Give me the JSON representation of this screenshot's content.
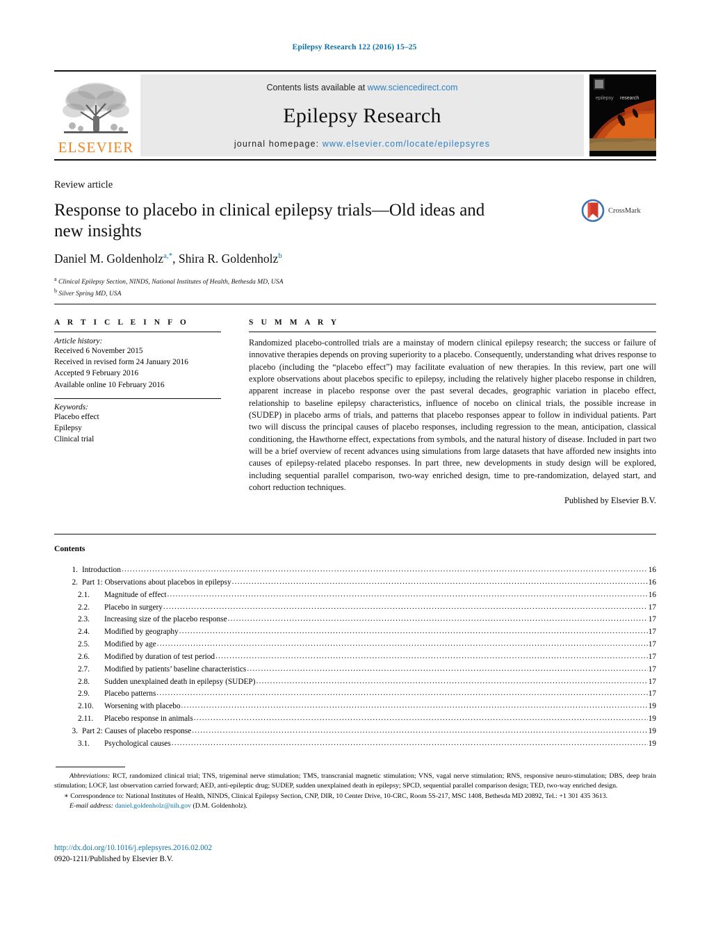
{
  "running_head": "Epilepsy Research 122 (2016) 15–25",
  "masthead": {
    "publisher_name": "ELSEVIER",
    "contents_prefix": "Contents lists available at ",
    "contents_link": "www.sciencedirect.com",
    "journal_title": "Epilepsy Research",
    "homepage_prefix": "journal homepage: ",
    "homepage_link": "www.elsevier.com/locate/epilepsyres",
    "cover_caption": "epilepsy research"
  },
  "article": {
    "kicker": "Review article",
    "title": "Response to placebo in clinical epilepsy trials—Old ideas and new insights",
    "authors": "Daniel M. Goldenholz",
    "author_1_sup": "a,*",
    "authors_2": ", Shira R. Goldenholz",
    "author_2_sup": "b",
    "affiliation_a_sup": "a",
    "affiliation_a": "Clinical Epilepsy Section, NINDS, National Institutes of Health, Bethesda MD, USA",
    "affiliation_b_sup": "b",
    "affiliation_b": "Silver Spring MD, USA",
    "crossmark_label": "CrossMark"
  },
  "article_info": {
    "heading": "A R T I C L E    I N F O",
    "history_label": "Article history:",
    "history": [
      "Received 6 November 2015",
      "Received in revised form 24 January 2016",
      "Accepted 9 February 2016",
      "Available online 10 February 2016"
    ],
    "keywords_label": "Keywords:",
    "keywords": [
      "Placebo effect",
      "Epilepsy",
      "Clinical trial"
    ]
  },
  "summary": {
    "heading": "S U M M A R Y",
    "body": "Randomized placebo-controlled trials are a mainstay of modern clinical epilepsy research; the success or failure of innovative therapies depends on proving superiority to a placebo. Consequently, understanding what drives response to placebo (including the “placebo effect”) may facilitate evaluation of new therapies. In this review, part one will explore observations about placebos specific to epilepsy, including the relatively higher placebo response in children, apparent increase in placebo response over the past several decades, geographic variation in placebo effect, relationship to baseline epilepsy characteristics, influence of nocebo on clinical trials, the possible increase in (SUDEP) in placebo arms of trials, and patterns that placebo responses appear to follow in individual patients. Part two will discuss the principal causes of placebo responses, including regression to the mean, anticipation, classical conditioning, the Hawthorne effect, expectations from symbols, and the natural history of disease. Included in part two will be a brief overview of recent advances using simulations from large datasets that have afforded new insights into causes of epilepsy-related placebo responses. In part three, new developments in study design will be explored, including sequential parallel comparison, two-way enriched design, time to pre-randomization, delayed start, and cohort reduction techniques.",
    "published_by": "Published by Elsevier B.V."
  },
  "contents": {
    "heading": "Contents",
    "entries": [
      {
        "level": 1,
        "number": "1.",
        "label": "Introduction",
        "page": "16"
      },
      {
        "level": 1,
        "number": "2.",
        "label": "Part 1: Observations about placebos in epilepsy",
        "page": "16"
      },
      {
        "level": 2,
        "number": "2.1.",
        "label": "Magnitude of effect",
        "page": "16"
      },
      {
        "level": 2,
        "number": "2.2.",
        "label": "Placebo in surgery",
        "page": "17"
      },
      {
        "level": 2,
        "number": "2.3.",
        "label": "Increasing size of the placebo response",
        "page": "17"
      },
      {
        "level": 2,
        "number": "2.4.",
        "label": "Modified by geography",
        "page": "17"
      },
      {
        "level": 2,
        "number": "2.5.",
        "label": "Modified by age",
        "page": "17"
      },
      {
        "level": 2,
        "number": "2.6.",
        "label": "Modified by duration of test period",
        "page": "17"
      },
      {
        "level": 2,
        "number": "2.7.",
        "label": "Modified by patients’ baseline characteristics",
        "page": "17"
      },
      {
        "level": 2,
        "number": "2.8.",
        "label": "Sudden unexplained death in epilepsy (SUDEP)",
        "page": "17"
      },
      {
        "level": 2,
        "number": "2.9.",
        "label": "Placebo patterns",
        "page": "17"
      },
      {
        "level": 2,
        "number": "2.10.",
        "label": "Worsening with placebo",
        "page": "19"
      },
      {
        "level": 2,
        "number": "2.11.",
        "label": "Placebo response in animals",
        "page": "19"
      },
      {
        "level": 1,
        "number": "3.",
        "label": "Part 2: Causes of placebo response",
        "page": "19"
      },
      {
        "level": 2,
        "number": "3.1.",
        "label": "Psychological causes",
        "page": "19"
      }
    ]
  },
  "footnotes": {
    "abbreviations_label": "Abbreviations:",
    "abbreviations_text": " RCT, randomized clinical trial; TNS, trigeminal nerve stimulation; TMS, transcranial magnetic stimulation; VNS, vagal nerve stimulation; RNS, responsive neuro-stimulation; DBS, deep brain stimulation; LOCF, last observation carried forward; AED, anti-epileptic drug; SUDEP, sudden unexplained death in epilepsy; SPCD, sequential parallel comparison design; TED, two-way enriched design.",
    "correspondence_marker": "∗",
    "correspondence_text": " Correspondence to: National Institutes of Health, NINDS, Clinical Epilepsy Section, CNP, DIR, 10 Center Drive, 10-CRC, Room 5S-217, MSC 1408, Bethesda MD 20892, Tel.: +1 301 435 3613.",
    "email_label": "E-mail address:",
    "email_link": "daniel.goldenholz@nih.gov",
    "email_suffix": " (D.M. Goldenholz)."
  },
  "bottom": {
    "doi": "http://dx.doi.org/10.1016/j.eplepsyres.2016.02.002",
    "issn_line": "0920-1211/Published by Elsevier B.V."
  },
  "colors": {
    "link_blue": "#0b72a8",
    "masthead_link": "#2f7fc1",
    "elsevier_orange": "#f08521",
    "masthead_bg": "#e9e9e9",
    "crossmark_red": "#d1392b",
    "crossmark_blue": "#3a72b5"
  }
}
